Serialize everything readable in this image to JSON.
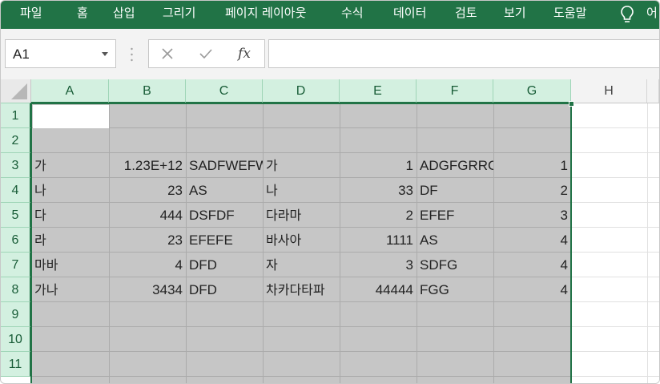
{
  "ribbon": {
    "tabs": [
      "파일",
      "홈",
      "삽입",
      "그리기",
      "페이지 레이아웃",
      "수식",
      "데이터",
      "검토",
      "보기",
      "도움말"
    ],
    "tell_me_partial": "어",
    "lightbulb_icon": "lightbulb-icon"
  },
  "formula_bar": {
    "name_box_value": "A1",
    "fx_label": "fx",
    "formula_value": "",
    "cancel_icon": "close-icon",
    "enter_icon": "check-icon"
  },
  "sheet": {
    "columns": [
      "A",
      "B",
      "C",
      "D",
      "E",
      "F",
      "G",
      "H"
    ],
    "rows": [
      "1",
      "2",
      "3",
      "4",
      "5",
      "6",
      "7",
      "8",
      "9",
      "10",
      "11"
    ],
    "data_rows": [
      {
        "row": "3",
        "a": "가",
        "b": "1.23E+12",
        "c": "SADFWEFW",
        "d": "가",
        "e": "1",
        "f": "ADGFGRRG",
        "g": "1"
      },
      {
        "row": "4",
        "a": "나",
        "b": "23",
        "c": "AS",
        "d": "나",
        "e": "33",
        "f": "DF",
        "g": "2"
      },
      {
        "row": "5",
        "a": "다",
        "b": "444",
        "c": "DSFDF",
        "d": "다라마",
        "e": "2",
        "f": "EFEF",
        "g": "3"
      },
      {
        "row": "6",
        "a": "라",
        "b": "23",
        "c": "EFEFE",
        "d": "바사아",
        "e": "1111",
        "f": "AS",
        "g": "4"
      },
      {
        "row": "7",
        "a": "마바",
        "b": "4",
        "c": "DFD",
        "d": "자",
        "e": "3",
        "f": "SDFG",
        "g": "4"
      },
      {
        "row": "8",
        "a": "가나",
        "b": "3434",
        "c": "DFD",
        "d": "차카다타파",
        "e": "44444",
        "f": "FGG",
        "g": "4"
      }
    ],
    "selected_range": "A1:G11",
    "active_cell": "A1"
  },
  "colors": {
    "ribbon": "#217346",
    "selection_fill": "#c6c6c6",
    "header_selected": "#d3f0e0",
    "selection_border": "#217346"
  }
}
